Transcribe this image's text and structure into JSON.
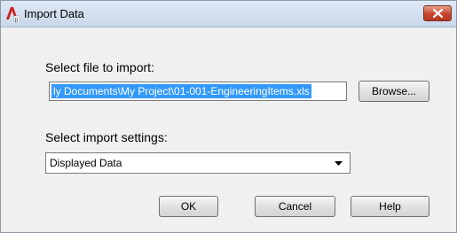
{
  "window": {
    "title": "Import Data",
    "icon": "autocad-app-icon",
    "close_icon": "close-icon"
  },
  "file": {
    "label": "Select file to import:",
    "path": "ly Documents\\My Project\\01-001-EngineeringItems.xls",
    "browse_label": "Browse..."
  },
  "settings": {
    "label": "Select import settings:",
    "selected": "Displayed Data"
  },
  "buttons": {
    "ok": "OK",
    "cancel": "Cancel",
    "help": "Help"
  },
  "colors": {
    "selection": "#3399ff",
    "close_button": "#c7442c",
    "dialog_bg": "#f0f0f0"
  }
}
